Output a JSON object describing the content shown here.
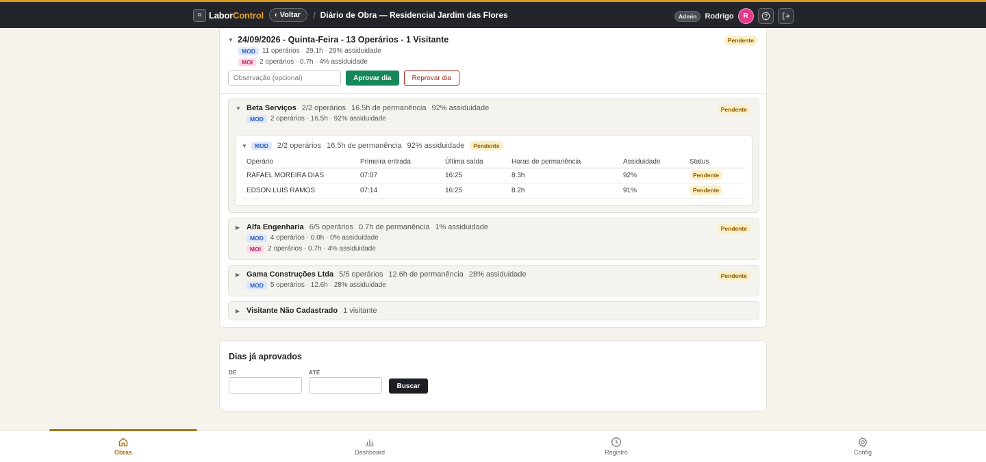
{
  "header": {
    "brand_main": "Labor",
    "brand_accent": "Control",
    "back_label": "Voltar",
    "separator": "/",
    "page_title": "Diário de Obra — Residencial Jardim das Flores",
    "role_badge": "Admin",
    "username": "Rodrigo",
    "avatar_initial": "R"
  },
  "day": {
    "title": "24/09/2026 - Quinta-Feira - 13 Operários - 1 Visitante",
    "status": "Pendente",
    "mod_tag": "MOD",
    "mod_stat": "11 operários · 29.1h · 29% assiduidade",
    "moi_tag": "MOI",
    "moi_stat": "2 operários · 0.7h · 4% assiduidade",
    "obs_placeholder": "Observação (opcional)",
    "approve_label": "Aprovar dia",
    "reject_label": "Reprovar dia"
  },
  "companies": [
    {
      "name": "Beta Serviços",
      "summary": [
        "2/2 operários",
        "16.5h de permanência",
        "92% assiduidade"
      ],
      "status": "Pendente",
      "stats": [
        {
          "tag": "MOD",
          "text": "2 operários · 16.5h · 92% assiduidade"
        }
      ],
      "detail": {
        "tag": "MOD",
        "summary": [
          "2/2 operários",
          "16.5h de permanência",
          "92% assiduidade"
        ],
        "status": "Pendente",
        "columns": [
          "Operário",
          "Primeira entrada",
          "Última saída",
          "Horas de permanência",
          "Assiduidade",
          "Status"
        ],
        "rows": [
          {
            "name": "RAFAEL MOREIRA DIAS",
            "entry": "07:07",
            "exit": "16:25",
            "hours": "8.3h",
            "attendance": "92%",
            "status": "Pendente"
          },
          {
            "name": "EDSON LUIS RAMOS",
            "entry": "07:14",
            "exit": "16:25",
            "hours": "8.2h",
            "attendance": "91%",
            "status": "Pendente"
          }
        ]
      }
    },
    {
      "name": "Alfa Engenharia",
      "summary": [
        "6/5 operários",
        "0.7h de permanência",
        "1% assiduidade"
      ],
      "status": "Pendente",
      "stats": [
        {
          "tag": "MOD",
          "text": "4 operários · 0.0h · 0% assiduidade"
        },
        {
          "tag": "MOI",
          "text": "2 operários · 0.7h · 4% assiduidade"
        }
      ]
    },
    {
      "name": "Gama Construções Ltda",
      "summary": [
        "5/5 operários",
        "12.6h de permanência",
        "28% assiduidade"
      ],
      "status": "Pendente",
      "stats": [
        {
          "tag": "MOD",
          "text": "5 operários · 12.6h · 28% assiduidade"
        }
      ]
    },
    {
      "name": "Visitante Não Cadastrado",
      "summary": [
        "1 visitante"
      ]
    }
  ],
  "approved": {
    "title": "Dias já aprovados",
    "from_label": "DE",
    "to_label": "ATÉ",
    "search_label": "Buscar"
  },
  "nav": {
    "items": [
      "Obras",
      "Dashboard",
      "Registro",
      "Config"
    ],
    "active": "Obras"
  },
  "colors": {
    "accent": "#d99a1e",
    "nav_active": "#a87619",
    "approve": "#16875a",
    "reject": "#b3261e",
    "avatar": "#e23a8a"
  }
}
